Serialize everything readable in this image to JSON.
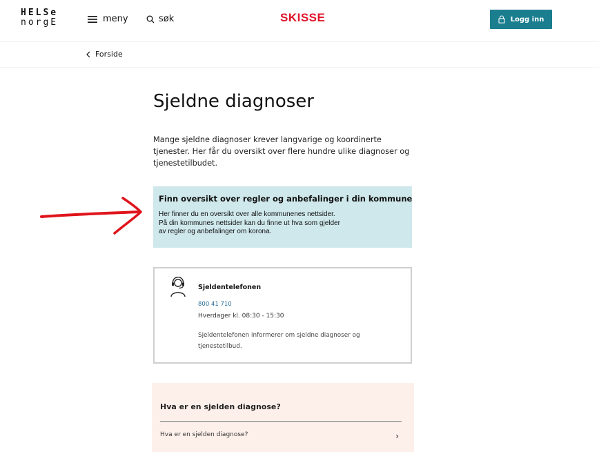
{
  "header": {
    "logo_line1": "HELSe",
    "logo_line2": "norgE",
    "menu_label": "meny",
    "search_label": "søk",
    "sketch_label": "SKISSE",
    "login_label": "Logg inn"
  },
  "breadcrumb": {
    "label": "Forside"
  },
  "main": {
    "title": "Sjeldne diagnoser",
    "intro": "Mange sjeldne diagnoser krever langvarige og koordinerte tjenester. Her får du oversikt over flere hundre ulike diagnoser og tjenestetilbudet."
  },
  "kommune_card": {
    "title": "Finn oversikt over regler og anbefalinger i din kommune",
    "lines": [
      "Her finner du en oversikt over alle kommunenes nettsider.",
      "På din kommunes nettsider kan du finne ut hva som gjelder",
      "av regler og anbefalinger om korona."
    ],
    "arrow_icon": "arrow-right-icon"
  },
  "annotation": {
    "color": "#e0141c",
    "icon": "hand-drawn-arrow"
  },
  "phone_card": {
    "title": "Sjeldentelefonen",
    "number": "800 41 710",
    "hours": "Hverdager kl. 08:30 - 15:30",
    "description": "Sjeldentelefonen informerer om sjeldne diagnoser og tjenestetilbud.",
    "icon": "headset-person-icon"
  },
  "faq": {
    "title": "Hva er en sjelden diagnose?",
    "items": [
      {
        "label": "Hva er en sjelden diagnose?"
      }
    ]
  },
  "colors": {
    "primary": "#1b7e8f",
    "card_bg": "#cfe8ec",
    "faq_bg": "#fdf0ea",
    "sketch_red": "#e0142b"
  }
}
